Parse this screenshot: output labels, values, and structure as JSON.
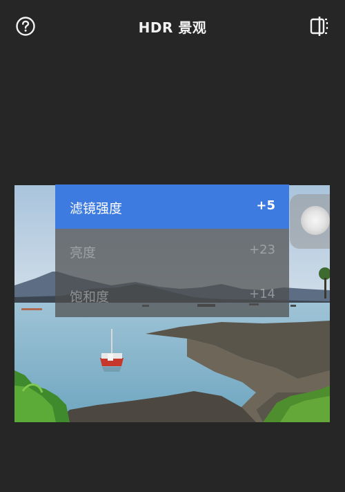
{
  "header": {
    "title": "HDR 景观",
    "help_icon": "help-circle-icon",
    "compare_icon": "compare-split-icon"
  },
  "menu": {
    "items": [
      {
        "label": "滤镜强度",
        "value": "+5",
        "active": true
      },
      {
        "label": "亮度",
        "value": "+23",
        "active": false
      },
      {
        "label": "饱和度",
        "value": "+14",
        "active": false
      }
    ]
  },
  "colors": {
    "background": "#262626",
    "accent": "#3d7be0"
  }
}
